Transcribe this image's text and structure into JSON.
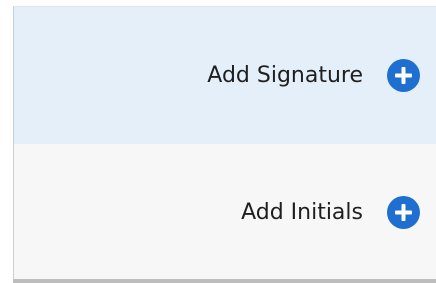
{
  "menu": {
    "items": [
      {
        "label": "Add Signature",
        "icon": "plus-circle-icon"
      },
      {
        "label": "Add Initials",
        "icon": "plus-circle-icon"
      }
    ]
  },
  "colors": {
    "accent": "#1e6fcf",
    "highlight_background": "#e5effa",
    "menu_background": "#f7f7f7"
  }
}
